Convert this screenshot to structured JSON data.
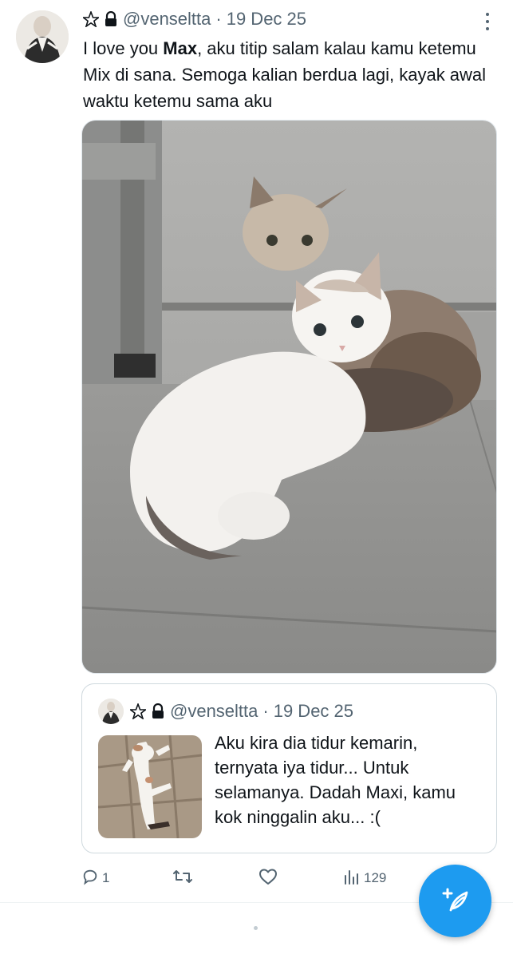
{
  "tweet": {
    "handle": "@venseltta",
    "separator": "·",
    "date": "19 Dec 25",
    "text_before": "I love you ",
    "text_bold": "Max",
    "text_after": ", aku titip salam kalau kamu ketemu Mix di sana. Semoga kalian berdua lagi, kayak awal waktu ketemu sama aku",
    "badge_icon": "pentagram-icon",
    "lock_icon": "lock-icon",
    "media_alt": "Two kittens sitting on a concrete floor",
    "more_icon": "more-vertical-icon"
  },
  "quote": {
    "handle": "@venseltta",
    "separator": "·",
    "date": "19 Dec 25",
    "text": "Aku kira dia tidur kemarin, ternyata iya tidur... Untuk selamanya. Dadah Maxi, kamu kok ninggalin aku... :("
  },
  "actions": {
    "reply_count": "1",
    "retweet_count": "",
    "like_count": "",
    "views_count": "129"
  },
  "fab": {
    "icon": "compose-feather-icon"
  },
  "colors": {
    "accent": "#1d9bf0",
    "text": "#0f1419",
    "muted": "#536471",
    "border": "#cfd9de"
  }
}
